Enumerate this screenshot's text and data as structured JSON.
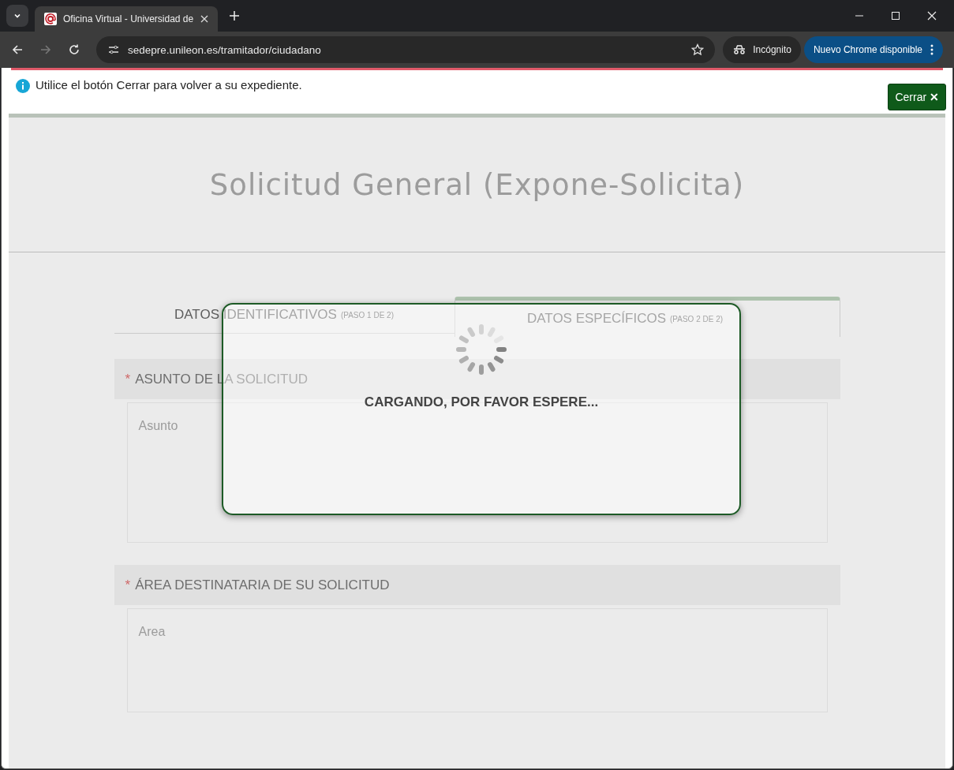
{
  "browser": {
    "tab_title": "Oficina Virtual - Universidad de",
    "url": "sedepre.unileon.es/tramitador/ciudadano",
    "incognito_label": "Incógnito",
    "update_button": "Nuevo Chrome disponible"
  },
  "info_bar": {
    "message": "Utilice el botón Cerrar para volver a su expediente.",
    "close_button": "Cerrar",
    "close_symbol": "✕"
  },
  "form": {
    "title": "Solicitud General (Expone-Solicita)",
    "steps": [
      {
        "label": "DATOS IDENTIFICATIVOS",
        "step": "(PASO 1 DE 2)",
        "selected": false
      },
      {
        "label": "DATOS ESPECÍFICOS",
        "step": "(PASO 2 DE 2)",
        "selected": true
      }
    ],
    "sections": [
      {
        "required_mark": "*",
        "heading": "ASUNTO DE LA SOLICITUD",
        "placeholder": "Asunto"
      },
      {
        "required_mark": "*",
        "heading": "ÁREA DESTINATARIA DE SU SOLICITUD",
        "placeholder": "Area"
      }
    ]
  },
  "loading_dialog": {
    "message": "CARGANDO, POR FAVOR ESPERE..."
  }
}
